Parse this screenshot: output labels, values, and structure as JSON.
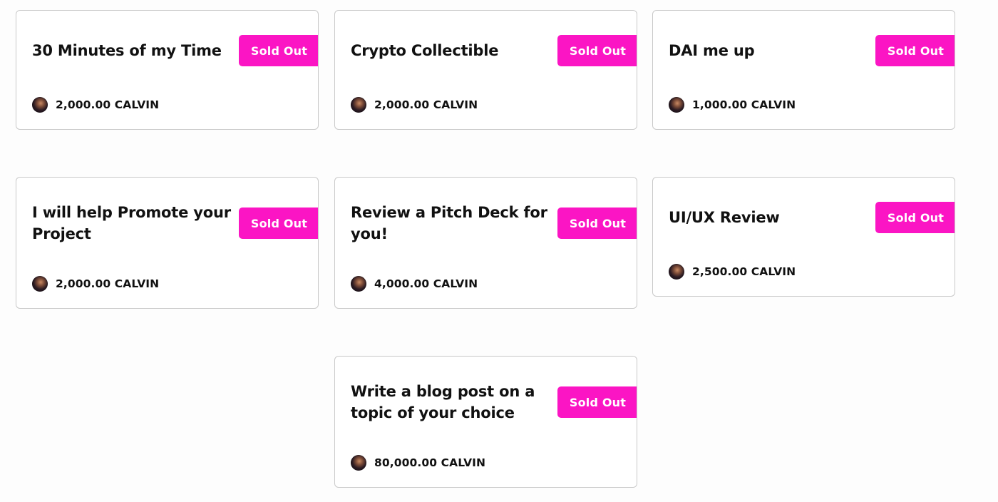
{
  "listings": [
    {
      "title": "30 Minutes of my Time",
      "status": "Sold Out",
      "price": "2,000.00 CALVIN"
    },
    {
      "title": "Crypto Collectible",
      "status": "Sold Out",
      "price": "2,000.00 CALVIN"
    },
    {
      "title": "DAI me up",
      "status": "Sold Out",
      "price": "1,000.00 CALVIN"
    },
    {
      "title": "I will help Promote your Project",
      "status": "Sold Out",
      "price": "2,000.00 CALVIN"
    },
    {
      "title": "Review a Pitch Deck for you!",
      "status": "Sold Out",
      "price": "4,000.00 CALVIN"
    },
    {
      "title": "UI/UX Review",
      "status": "Sold Out",
      "price": "2,500.00 CALVIN"
    },
    {
      "title": "Write a blog post on a topic of your choice",
      "status": "Sold Out",
      "price": "80,000.00 CALVIN"
    }
  ],
  "colors": {
    "accent": "#fb15c4",
    "border": "#c9c9c9"
  },
  "icons": {
    "seller_avatar": "avatar-image"
  }
}
